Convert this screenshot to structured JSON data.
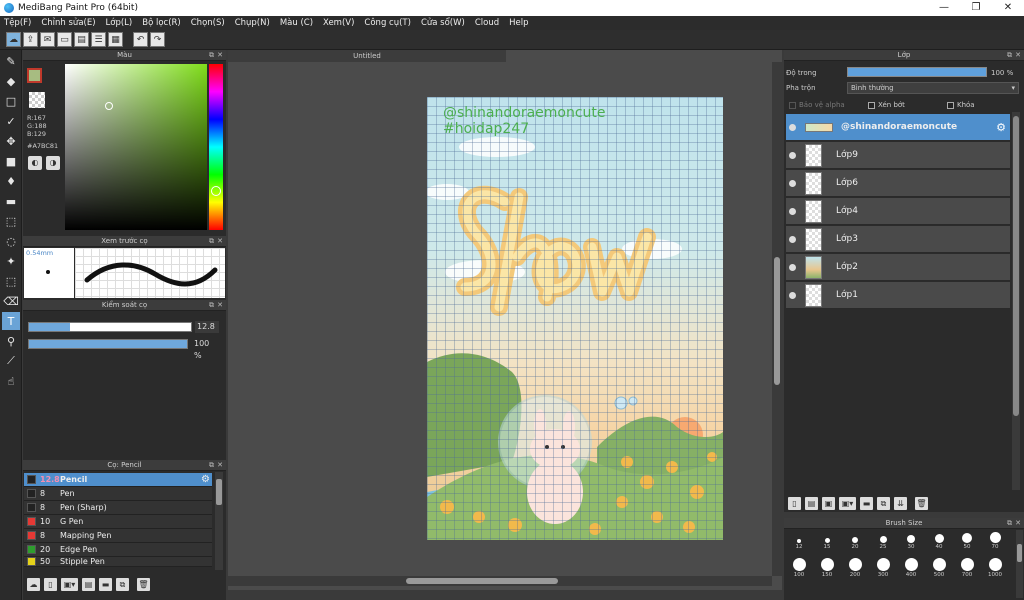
{
  "window": {
    "title": "MediBang Paint Pro (64bit)",
    "minimize": "—",
    "maximize": "❐",
    "close": "✕"
  },
  "menu": [
    "Tệp(F)",
    "Chỉnh sửa(E)",
    "Lớp(L)",
    "Bộ lọc(R)",
    "Chọn(S)",
    "Chụp(N)",
    "Màu (C)",
    "Xem(V)",
    "Công cụ(T)",
    "Cửa sổ(W)",
    "Cloud",
    "Help"
  ],
  "color_panel": {
    "title": "Màu",
    "r": "R:167",
    "g": "G:188",
    "b": "B:129",
    "hex": "#A7BC81",
    "fg_color": "#A7BC81"
  },
  "brush_preview": {
    "title": "Xem trước cọ",
    "size": "0.54mm"
  },
  "brush_control": {
    "title": "Kiểm soát cọ",
    "size_value": "12.8",
    "size_fraction": 0.25,
    "opacity_value": "100 %",
    "opacity_fraction": 1.0
  },
  "brush_list": {
    "title": "Cọ: Pencil",
    "items": [
      {
        "size": "12.8",
        "name": "Pencil",
        "color": "#222222"
      },
      {
        "size": "8",
        "name": "Pen",
        "color": "#222222"
      },
      {
        "size": "8",
        "name": "Pen (Sharp)",
        "color": "#222222"
      },
      {
        "size": "10",
        "name": "G Pen",
        "color": "#e53935"
      },
      {
        "size": "8",
        "name": "Mapping Pen",
        "color": "#e53935"
      },
      {
        "size": "20",
        "name": "Edge Pen",
        "color": "#2e9d2e"
      },
      {
        "size": "50",
        "name": "Stipple Pen",
        "color": "#e5d21a"
      }
    ]
  },
  "document": {
    "tab": "Untitled",
    "watermark_line1": "@shinandoraemoncute",
    "watermark_line2": "#hoidap247"
  },
  "layer_panel": {
    "title": "Lớp",
    "opacity_label": "Độ trong",
    "opacity_value": "100 %",
    "opacity_fraction": 1.0,
    "blend_label": "Pha trộn",
    "blend_value": "Bình thường",
    "alpha_protect": "Bảo vệ alpha",
    "clipping": "Xén bớt",
    "lock": "Khóa",
    "layers": [
      "@shinandoraemoncute",
      "Lớp9",
      "Lớp6",
      "Lớp4",
      "Lớp3",
      "Lớp2",
      "Lớp1"
    ]
  },
  "brush_size": {
    "title": "Brush Size",
    "sizes_row1": [
      "12",
      "15",
      "20",
      "25",
      "30",
      "40",
      "50",
      "70"
    ],
    "sizes_row2": [
      "100",
      "150",
      "200",
      "300",
      "400",
      "500",
      "700",
      "1000"
    ]
  }
}
